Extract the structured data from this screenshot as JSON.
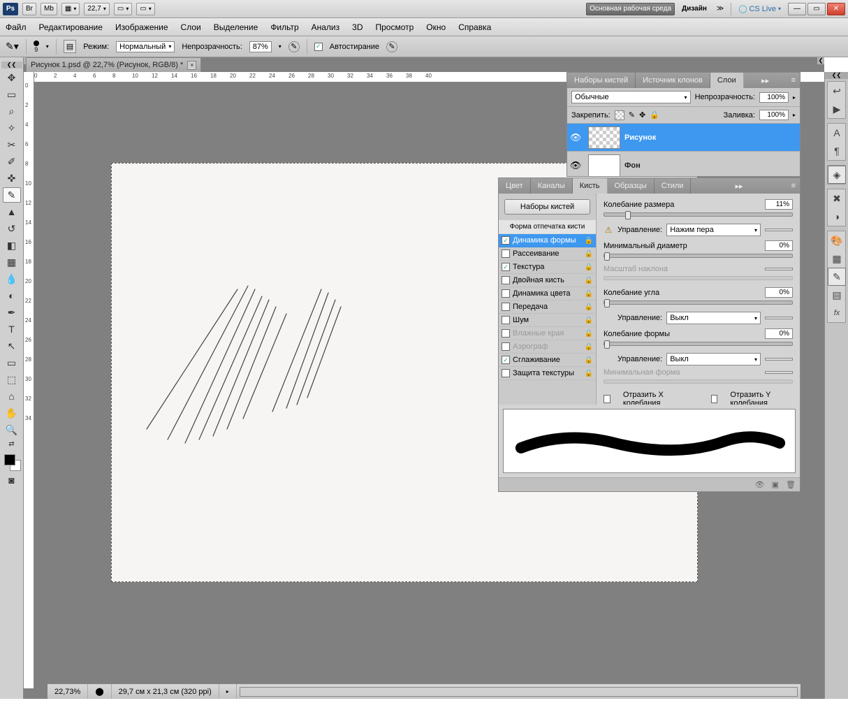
{
  "titlebar": {
    "logo": "Ps",
    "br": "Br",
    "mb": "Mb",
    "zoom": "22,7",
    "workspace_main": "Основная рабочая среда",
    "workspace_design": "Дизайн",
    "cslive": "CS Live"
  },
  "menu": {
    "file": "Файл",
    "edit": "Редактирование",
    "image": "Изображение",
    "layer": "Слои",
    "select": "Выделение",
    "filter": "Фильтр",
    "analysis": "Анализ",
    "threed": "3D",
    "view": "Просмотр",
    "window": "Окно",
    "help": "Справка"
  },
  "optbar": {
    "size_label": "9",
    "mode_label": "Режим:",
    "mode_value": "Нормальный",
    "opacity_label": "Непрозрачность:",
    "opacity_value": "87%",
    "autoerase": "Автостирание"
  },
  "document": {
    "tab_title": "Рисунок 1.psd @ 22,7% (Рисунок, RGB/8) *",
    "ruler_h": [
      "0",
      "2",
      "4",
      "6",
      "8",
      "10",
      "12",
      "14",
      "16",
      "18",
      "20",
      "22",
      "24",
      "26",
      "28",
      "30",
      "32",
      "34",
      "36",
      "38",
      "40"
    ],
    "ruler_v": [
      "0",
      "2",
      "4",
      "6",
      "8",
      "10",
      "12",
      "14",
      "16",
      "18",
      "20",
      "22",
      "24",
      "26",
      "28",
      "30",
      "32",
      "34"
    ]
  },
  "layers_panel": {
    "tabs": {
      "brushpresets": "Наборы кистей",
      "clonesrc": "Источник клонов",
      "layers": "Слои"
    },
    "blend_mode": "Обычные",
    "opacity_label": "Непрозрачность:",
    "opacity_value": "100%",
    "lock_label": "Закрепить:",
    "fill_label": "Заливка:",
    "fill_value": "100%",
    "layers": [
      {
        "name": "Рисунок",
        "selected": true
      },
      {
        "name": "Фон",
        "selected": false
      }
    ]
  },
  "brush_panel": {
    "tabs": {
      "color": "Цвет",
      "channels": "Каналы",
      "brush": "Кисть",
      "swatches": "Образцы",
      "styles": "Стили"
    },
    "presets_btn": "Наборы кистей",
    "tip_shape": "Форма отпечатка кисти",
    "items": [
      {
        "label": "Динамика формы",
        "checked": true,
        "selected": true
      },
      {
        "label": "Рассеивание",
        "checked": false
      },
      {
        "label": "Текстура",
        "checked": true
      },
      {
        "label": "Двойная кисть",
        "checked": false
      },
      {
        "label": "Динамика цвета",
        "checked": false
      },
      {
        "label": "Передача",
        "checked": false
      },
      {
        "label": "Шум",
        "checked": false
      },
      {
        "label": "Влажные края",
        "checked": false,
        "disabled": true
      },
      {
        "label": "Аэрограф",
        "checked": false,
        "disabled": true
      },
      {
        "label": "Сглаживание",
        "checked": true
      },
      {
        "label": "Защита текстуры",
        "checked": false
      }
    ],
    "right": {
      "size_jitter": "Колебание размера",
      "size_jitter_val": "11%",
      "control": "Управление:",
      "control_size": "Нажим пера",
      "min_diam": "Минимальный диаметр",
      "min_diam_val": "0%",
      "tilt_scale": "Масштаб наклона",
      "angle_jitter": "Колебание угла",
      "angle_jitter_val": "0%",
      "control_off": "Выкл",
      "round_jitter": "Колебание формы",
      "round_jitter_val": "0%",
      "min_round": "Минимальная форма",
      "flip_x": "Отразить X колебания",
      "flip_y": "Отразить Y колебания"
    }
  },
  "statusbar": {
    "zoom": "22,73%",
    "dims": "29,7 см x 21,3 см (320 ppi)"
  }
}
